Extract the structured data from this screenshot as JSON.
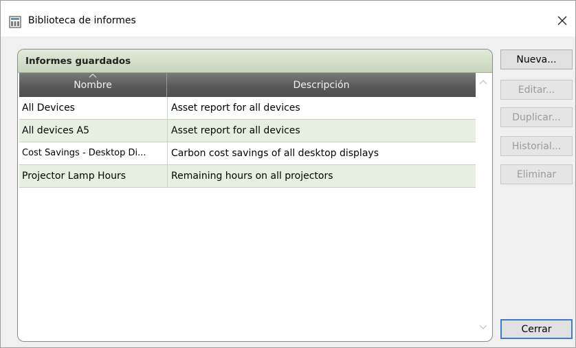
{
  "window": {
    "title": "Biblioteca de informes",
    "icon": "report-library-icon"
  },
  "group": {
    "title": "Informes guardados"
  },
  "table": {
    "columns": [
      "Nombre",
      "Descripción"
    ],
    "sort_indicator": "chevron-up-icon",
    "rows": [
      {
        "name": "All Devices",
        "description": "Asset report for all devices"
      },
      {
        "name": "All devices A5",
        "description": "Asset report for all devices"
      },
      {
        "name": "Cost Savings - Desktop Di...",
        "description": "Carbon cost savings of all desktop displays"
      },
      {
        "name": "Projector Lamp Hours",
        "description": "Remaining hours on all projectors"
      }
    ]
  },
  "buttons": {
    "nueva": "Nueva...",
    "editar": "Editar...",
    "duplicar": "Duplicar...",
    "historial": "Historial...",
    "eliminar": "Eliminar",
    "cerrar": "Cerrar"
  },
  "colors": {
    "header_bg": "#5a5a5a",
    "alt_row": "#e7efe3",
    "group_header": "#c8d4bc",
    "primary_border": "#3e7cc9"
  }
}
